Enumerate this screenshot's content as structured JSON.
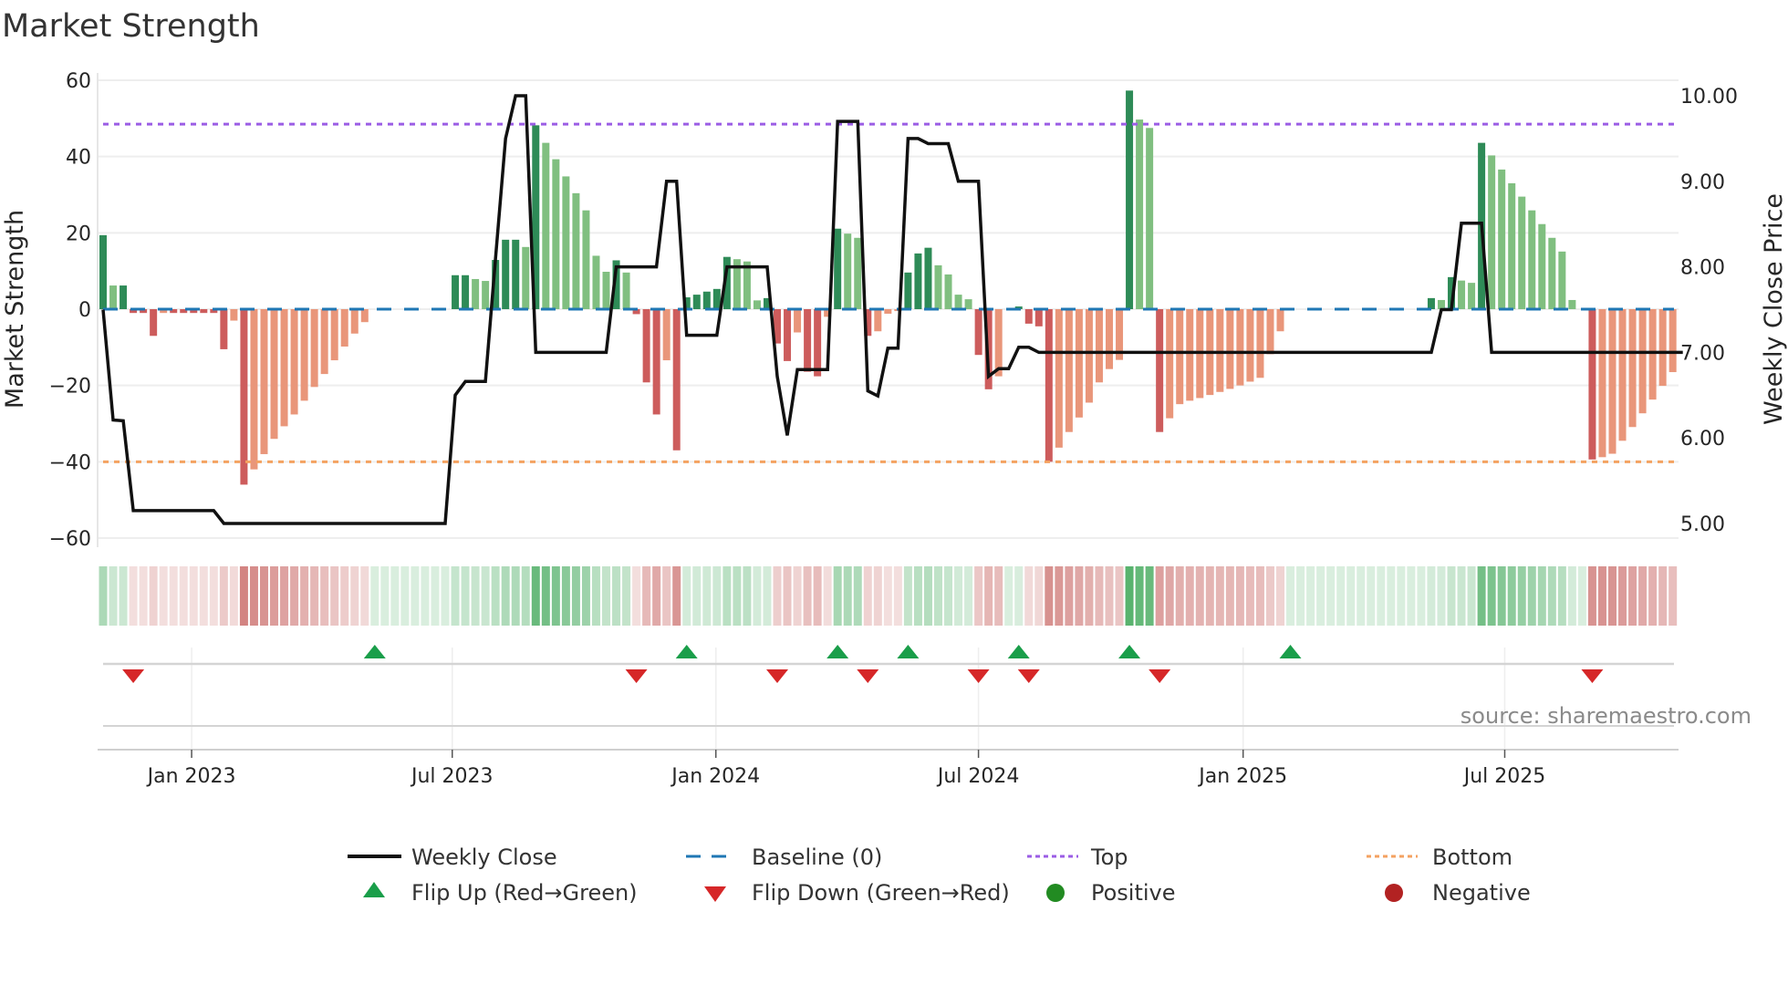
{
  "chart_data": {
    "type": "bar",
    "title": "Market Strength",
    "ylabel": "Market Strength",
    "y2label": "Weekly Close Price",
    "ylim": [
      -62,
      62
    ],
    "y2lim": [
      4.82,
      10.21
    ],
    "yticks": [
      "−60",
      "−40",
      "−20",
      "0",
      "20",
      "40",
      "60"
    ],
    "ytick_values": [
      -60,
      -40,
      -20,
      0,
      20,
      40,
      60
    ],
    "y2ticks": [
      "5.00",
      "6.00",
      "7.00",
      "8.00",
      "9.00",
      "10.00"
    ],
    "y2tick_values": [
      5,
      6,
      7,
      8,
      9,
      10
    ],
    "xticks": [
      {
        "label": "Jan 2023",
        "week": 8.8
      },
      {
        "label": "Jul 2023",
        "week": 34.7
      },
      {
        "label": "Jan 2024",
        "week": 60.9
      },
      {
        "label": "Jul 2024",
        "week": 87.0
      },
      {
        "label": "Jan 2025",
        "week": 113.3
      },
      {
        "label": "Jul 2025",
        "week": 139.3
      }
    ],
    "grid": true,
    "reference_lines": {
      "baseline": 0,
      "top": 48.5,
      "bottom": -40
    },
    "strength": [
      19.4,
      6.2,
      6.2,
      -1,
      -1,
      -7,
      -1,
      -1,
      -1,
      -1,
      -1,
      -1,
      -10.5,
      -3,
      -46,
      -42,
      -38,
      -34,
      -30.7,
      -27.6,
      -24,
      -20.4,
      -17,
      -13.4,
      -9.8,
      -6.4,
      -3.4,
      0,
      0,
      0,
      0,
      0,
      0,
      0,
      0,
      8.9,
      8.9,
      7.9,
      7.4,
      12.9,
      18.2,
      18.2,
      16.3,
      48.2,
      43.6,
      39.3,
      34.8,
      30.4,
      25.9,
      14,
      9.8,
      12.8,
      9.6,
      -1.3,
      -19.2,
      -27.6,
      -13.4,
      -37,
      3.1,
      3.8,
      4.6,
      5.3,
      13.7,
      13.1,
      12.5,
      2.3,
      2.9,
      -9,
      -13.6,
      -6.1,
      -16.4,
      -17.6,
      -2,
      21.1,
      19.8,
      18.7,
      -7,
      -5.8,
      -1.2,
      -0.5,
      9.6,
      14.6,
      16.1,
      11.5,
      9.1,
      3.8,
      2.6,
      -12,
      -21,
      -17.6,
      0,
      0.7,
      -3.8,
      -4.5,
      -40,
      -36.3,
      -32.2,
      -28.4,
      -24.5,
      -19.2,
      -15.7,
      -13.3,
      57.3,
      49.7,
      47.5,
      -32.2,
      -28.6,
      -24.9,
      -24,
      -23.3,
      -22.5,
      -21.7,
      -20.9,
      -20,
      -19,
      -18,
      -11.8,
      -5.8,
      0,
      0,
      0,
      0,
      0,
      0,
      0,
      0,
      0,
      0,
      0,
      0,
      0,
      0,
      2.9,
      2.4,
      8.4,
      7.5,
      6.9,
      43.6,
      40.3,
      36.6,
      33,
      29.5,
      25.9,
      22.3,
      18.7,
      15.1,
      2.4,
      0,
      -39.4,
      -38.8,
      -37.9,
      -34.5,
      -30.9,
      -27.3,
      -23.7,
      -20.1,
      -16.5
    ],
    "weekly_close": [
      7.5,
      6.21,
      6.2,
      5.15,
      5.15,
      5.15,
      5.15,
      5.15,
      5.15,
      5.15,
      5.15,
      5.15,
      5,
      5,
      5,
      5,
      5,
      5,
      5,
      5,
      5,
      5,
      5,
      5,
      5,
      5,
      5,
      5,
      5,
      5,
      5,
      5,
      5,
      5,
      5,
      6.5,
      6.66,
      6.66,
      6.66,
      8.1,
      9.5,
      10,
      10,
      7,
      7,
      7,
      7,
      7,
      7,
      7,
      7,
      8,
      8,
      8,
      8,
      8,
      9,
      9,
      7.2,
      7.2,
      7.2,
      7.2,
      8,
      8,
      8,
      8,
      8,
      6.72,
      6.03,
      6.8,
      6.8,
      6.8,
      6.8,
      9.7,
      9.7,
      9.7,
      6.55,
      6.49,
      7.05,
      7.05,
      9.5,
      9.5,
      9.44,
      9.44,
      9.44,
      9,
      9,
      9,
      6.72,
      6.81,
      6.81,
      7.06,
      7.06,
      7,
      7,
      7,
      7,
      7,
      7,
      7,
      7,
      7,
      7,
      7,
      7,
      7,
      7,
      7,
      7,
      7,
      7,
      7,
      7,
      7,
      7,
      7,
      7,
      7,
      7,
      7,
      7,
      7,
      7,
      7,
      7,
      7,
      7,
      7,
      7,
      7,
      7,
      7,
      7,
      7.5,
      7.5,
      8.51,
      8.51,
      8.51,
      7,
      7,
      7,
      7,
      7,
      7,
      7,
      7,
      7,
      7,
      7,
      7,
      7,
      7,
      7,
      7,
      7,
      7,
      7,
      7
    ],
    "flip_up_weeks": [
      27,
      58,
      73,
      80,
      91,
      102,
      118
    ],
    "flip_down_weeks": [
      3,
      53,
      67,
      76,
      87,
      92,
      105,
      148
    ],
    "legend": {
      "placement": "bottom",
      "items": [
        {
          "label": "Weekly Close",
          "key": "line"
        },
        {
          "label": "Baseline (0)",
          "key": "baseline"
        },
        {
          "label": "Top",
          "key": "top"
        },
        {
          "label": "Bottom",
          "key": "bottom"
        },
        {
          "label": "Flip Up (Red→Green)",
          "key": "flip-up"
        },
        {
          "label": "Flip Down (Green→Red)",
          "key": "flip-down"
        },
        {
          "label": "Positive",
          "key": "positive"
        },
        {
          "label": "Negative",
          "key": "negative"
        }
      ]
    },
    "source": "source: sharemaestro.com"
  },
  "colors": {
    "rising_positive": "#2e8b57",
    "falling_positive": "#80bf80",
    "falling_negative": "#cd5c5c",
    "rising_negative": "#e9967a",
    "line": "#111111",
    "baseline": "#1f77b4",
    "top": "#9b5de5",
    "bottom": "#f4a261",
    "flip_up": "#1a9e4a",
    "flip_down": "#d62728",
    "positive": "#228b22",
    "negative": "#b22222",
    "heat_green": "#2fa04a",
    "heat_red": "#c0504d"
  }
}
